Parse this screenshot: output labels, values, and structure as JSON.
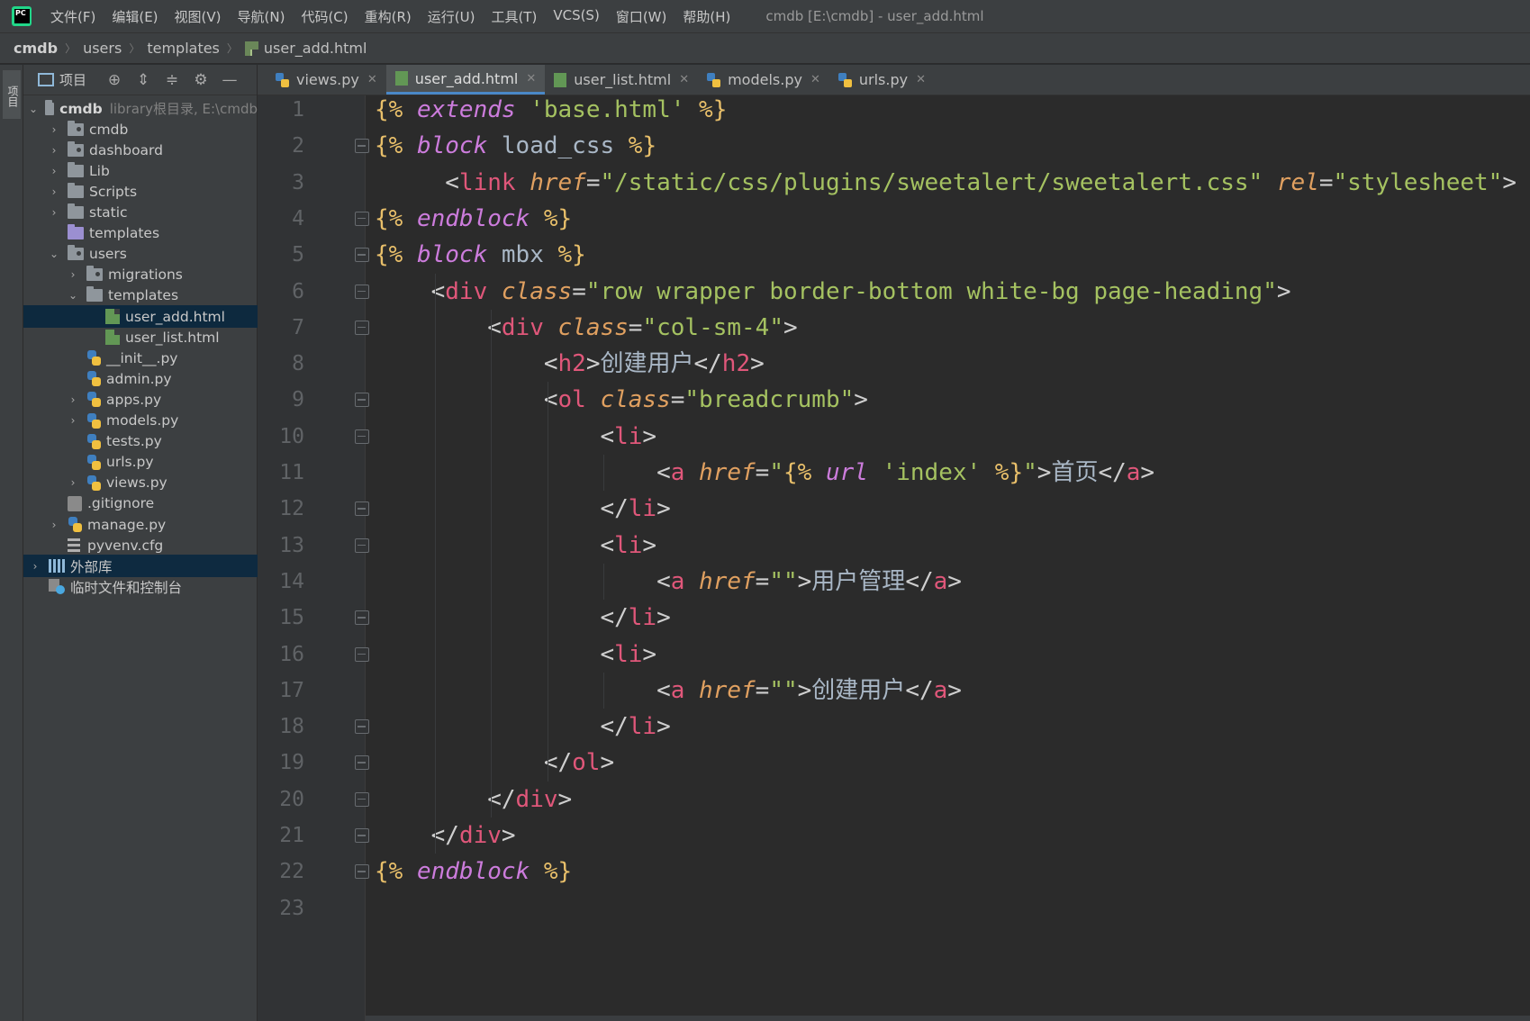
{
  "menubar": {
    "items": [
      "文件(F)",
      "编辑(E)",
      "视图(V)",
      "导航(N)",
      "代码(C)",
      "重构(R)",
      "运行(U)",
      "工具(T)",
      "VCS(S)",
      "窗口(W)",
      "帮助(H)"
    ],
    "window_title": "cmdb [E:\\cmdb] - user_add.html"
  },
  "breadcrumb": {
    "items": [
      "cmdb",
      "users",
      "templates",
      "user_add.html"
    ]
  },
  "tool_stripe": {
    "project_label": "项目"
  },
  "project_panel": {
    "title": "项目",
    "tree": [
      {
        "label": "cmdb",
        "hint": "library根目录, E:\\cmdb",
        "depth": 0,
        "arrow": "down",
        "icon": "folder",
        "bold": true
      },
      {
        "label": "cmdb",
        "depth": 1,
        "arrow": "right",
        "icon": "folder-module"
      },
      {
        "label": "dashboard",
        "depth": 1,
        "arrow": "right",
        "icon": "folder-module"
      },
      {
        "label": "Lib",
        "depth": 1,
        "arrow": "right",
        "icon": "folder"
      },
      {
        "label": "Scripts",
        "depth": 1,
        "arrow": "right",
        "icon": "folder"
      },
      {
        "label": "static",
        "depth": 1,
        "arrow": "right",
        "icon": "folder"
      },
      {
        "label": "templates",
        "depth": 1,
        "arrow": "none",
        "icon": "folder-templates"
      },
      {
        "label": "users",
        "depth": 1,
        "arrow": "down",
        "icon": "folder-module"
      },
      {
        "label": "migrations",
        "depth": 2,
        "arrow": "right",
        "icon": "folder-module"
      },
      {
        "label": "templates",
        "depth": 2,
        "arrow": "down",
        "icon": "folder"
      },
      {
        "label": "user_add.html",
        "depth": 3,
        "arrow": "none",
        "icon": "html",
        "selected": true
      },
      {
        "label": "user_list.html",
        "depth": 3,
        "arrow": "none",
        "icon": "html"
      },
      {
        "label": "__init__.py",
        "depth": 2,
        "arrow": "none",
        "icon": "py"
      },
      {
        "label": "admin.py",
        "depth": 2,
        "arrow": "none",
        "icon": "py"
      },
      {
        "label": "apps.py",
        "depth": 2,
        "arrow": "right",
        "icon": "py"
      },
      {
        "label": "models.py",
        "depth": 2,
        "arrow": "right",
        "icon": "py"
      },
      {
        "label": "tests.py",
        "depth": 2,
        "arrow": "none",
        "icon": "py"
      },
      {
        "label": "urls.py",
        "depth": 2,
        "arrow": "none",
        "icon": "py"
      },
      {
        "label": "views.py",
        "depth": 2,
        "arrow": "right",
        "icon": "py"
      },
      {
        "label": ".gitignore",
        "depth": 1,
        "arrow": "none",
        "icon": "git"
      },
      {
        "label": "manage.py",
        "depth": 1,
        "arrow": "right",
        "icon": "py"
      },
      {
        "label": "pyvenv.cfg",
        "depth": 1,
        "arrow": "none",
        "icon": "cfg"
      },
      {
        "label": "外部库",
        "depth": 0,
        "arrow": "right",
        "icon": "library",
        "library_selected": true
      },
      {
        "label": "临时文件和控制台",
        "depth": 0,
        "arrow": "none",
        "icon": "scratch"
      }
    ]
  },
  "tabs": [
    {
      "label": "views.py",
      "icon": "py",
      "active": false
    },
    {
      "label": "user_add.html",
      "icon": "html",
      "active": true
    },
    {
      "label": "user_list.html",
      "icon": "html",
      "active": false
    },
    {
      "label": "models.py",
      "icon": "py",
      "active": false
    },
    {
      "label": "urls.py",
      "icon": "py",
      "active": false
    }
  ],
  "editor": {
    "lines": [
      {
        "n": "1",
        "fold": "",
        "tokens": [
          [
            "tpl",
            "{% "
          ],
          [
            "kw",
            "extends"
          ],
          [
            "plain",
            " "
          ],
          [
            "str",
            "'base.html'"
          ],
          [
            "tpl",
            " %}"
          ]
        ]
      },
      {
        "n": "2",
        "fold": "open",
        "tokens": [
          [
            "tpl",
            "{% "
          ],
          [
            "kw",
            "block"
          ],
          [
            "plain",
            " load_css "
          ],
          [
            "tpl",
            "%}"
          ]
        ]
      },
      {
        "n": "3",
        "fold": "",
        "tokens": [
          [
            "plain",
            "     "
          ],
          [
            "bracket",
            "<"
          ],
          [
            "tagname",
            "link"
          ],
          [
            "plain",
            " "
          ],
          [
            "attr",
            "href"
          ],
          [
            "bracket",
            "="
          ],
          [
            "str",
            "\"/static/css/plugins/sweetalert/sweetalert.css\""
          ],
          [
            "plain",
            " "
          ],
          [
            "attr",
            "rel"
          ],
          [
            "bracket",
            "="
          ],
          [
            "str",
            "\"stylesheet\""
          ],
          [
            "bracket",
            ">"
          ]
        ]
      },
      {
        "n": "4",
        "fold": "close",
        "tokens": [
          [
            "tpl",
            "{% "
          ],
          [
            "kw",
            "endblock"
          ],
          [
            "plain",
            " "
          ],
          [
            "tpl",
            "%}"
          ]
        ]
      },
      {
        "n": "5",
        "fold": "open",
        "tokens": [
          [
            "tpl",
            "{% "
          ],
          [
            "kw",
            "block"
          ],
          [
            "plain",
            " mbx "
          ],
          [
            "tpl",
            "%}"
          ]
        ]
      },
      {
        "n": "6",
        "fold": "open",
        "tokens": [
          [
            "plain",
            "    "
          ],
          [
            "bracket",
            "<"
          ],
          [
            "tagname",
            "div"
          ],
          [
            "plain",
            " "
          ],
          [
            "attr",
            "class"
          ],
          [
            "bracket",
            "="
          ],
          [
            "str",
            "\"row wrapper border-bottom white-bg page-heading\""
          ],
          [
            "bracket",
            ">"
          ]
        ]
      },
      {
        "n": "7",
        "fold": "open",
        "tokens": [
          [
            "plain",
            "        "
          ],
          [
            "bracket",
            "<"
          ],
          [
            "tagname",
            "div"
          ],
          [
            "plain",
            " "
          ],
          [
            "attr",
            "class"
          ],
          [
            "bracket",
            "="
          ],
          [
            "str",
            "\"col-sm-4\""
          ],
          [
            "bracket",
            ">"
          ]
        ]
      },
      {
        "n": "8",
        "fold": "",
        "tokens": [
          [
            "plain",
            "            "
          ],
          [
            "bracket",
            "<"
          ],
          [
            "tagname",
            "h2"
          ],
          [
            "bracket",
            ">"
          ],
          [
            "plain",
            "创建用户"
          ],
          [
            "bracket",
            "</"
          ],
          [
            "tagname",
            "h2"
          ],
          [
            "bracket",
            ">"
          ]
        ]
      },
      {
        "n": "9",
        "fold": "open",
        "tokens": [
          [
            "plain",
            "            "
          ],
          [
            "bracket",
            "<"
          ],
          [
            "tagname",
            "ol"
          ],
          [
            "plain",
            " "
          ],
          [
            "attr",
            "class"
          ],
          [
            "bracket",
            "="
          ],
          [
            "str",
            "\"breadcrumb\""
          ],
          [
            "bracket",
            ">"
          ]
        ]
      },
      {
        "n": "10",
        "fold": "open",
        "tokens": [
          [
            "plain",
            "                "
          ],
          [
            "bracket",
            "<"
          ],
          [
            "tagname",
            "li"
          ],
          [
            "bracket",
            ">"
          ]
        ]
      },
      {
        "n": "11",
        "fold": "",
        "tokens": [
          [
            "plain",
            "                    "
          ],
          [
            "bracket",
            "<"
          ],
          [
            "tagname",
            "a"
          ],
          [
            "plain",
            " "
          ],
          [
            "attr",
            "href"
          ],
          [
            "bracket",
            "="
          ],
          [
            "str",
            "\""
          ],
          [
            "tpl",
            "{% "
          ],
          [
            "kw",
            "url"
          ],
          [
            "plain",
            " "
          ],
          [
            "str",
            "'index'"
          ],
          [
            "tpl",
            " %}"
          ],
          [
            "str",
            "\""
          ],
          [
            "bracket",
            ">"
          ],
          [
            "plain",
            "首页"
          ],
          [
            "bracket",
            "</"
          ],
          [
            "tagname",
            "a"
          ],
          [
            "bracket",
            ">"
          ]
        ]
      },
      {
        "n": "12",
        "fold": "close",
        "tokens": [
          [
            "plain",
            "                "
          ],
          [
            "bracket",
            "</"
          ],
          [
            "tagname",
            "li"
          ],
          [
            "bracket",
            ">"
          ]
        ]
      },
      {
        "n": "13",
        "fold": "open",
        "tokens": [
          [
            "plain",
            "                "
          ],
          [
            "bracket",
            "<"
          ],
          [
            "tagname",
            "li"
          ],
          [
            "bracket",
            ">"
          ]
        ]
      },
      {
        "n": "14",
        "fold": "",
        "tokens": [
          [
            "plain",
            "                    "
          ],
          [
            "bracket",
            "<"
          ],
          [
            "tagname",
            "a"
          ],
          [
            "plain",
            " "
          ],
          [
            "attr",
            "href"
          ],
          [
            "bracket",
            "="
          ],
          [
            "str",
            "\"\""
          ],
          [
            "bracket",
            ">"
          ],
          [
            "plain",
            "用户管理"
          ],
          [
            "bracket",
            "</"
          ],
          [
            "tagname",
            "a"
          ],
          [
            "bracket",
            ">"
          ]
        ]
      },
      {
        "n": "15",
        "fold": "close",
        "tokens": [
          [
            "plain",
            "                "
          ],
          [
            "bracket",
            "</"
          ],
          [
            "tagname",
            "li"
          ],
          [
            "bracket",
            ">"
          ]
        ]
      },
      {
        "n": "16",
        "fold": "open",
        "tokens": [
          [
            "plain",
            "                "
          ],
          [
            "bracket",
            "<"
          ],
          [
            "tagname",
            "li"
          ],
          [
            "bracket",
            ">"
          ]
        ]
      },
      {
        "n": "17",
        "fold": "",
        "tokens": [
          [
            "plain",
            "                    "
          ],
          [
            "bracket",
            "<"
          ],
          [
            "tagname",
            "a"
          ],
          [
            "plain",
            " "
          ],
          [
            "attr",
            "href"
          ],
          [
            "bracket",
            "="
          ],
          [
            "str",
            "\"\""
          ],
          [
            "bracket",
            ">"
          ],
          [
            "plain",
            "创建用户"
          ],
          [
            "bracket",
            "</"
          ],
          [
            "tagname",
            "a"
          ],
          [
            "bracket",
            ">"
          ]
        ]
      },
      {
        "n": "18",
        "fold": "close",
        "tokens": [
          [
            "plain",
            "                "
          ],
          [
            "bracket",
            "</"
          ],
          [
            "tagname",
            "li"
          ],
          [
            "bracket",
            ">"
          ]
        ]
      },
      {
        "n": "19",
        "fold": "close",
        "tokens": [
          [
            "plain",
            "            "
          ],
          [
            "bracket",
            "</"
          ],
          [
            "tagname",
            "ol"
          ],
          [
            "bracket",
            ">"
          ]
        ]
      },
      {
        "n": "20",
        "fold": "close",
        "tokens": [
          [
            "plain",
            "        "
          ],
          [
            "bracket",
            "</"
          ],
          [
            "tagname",
            "div"
          ],
          [
            "bracket",
            ">"
          ]
        ]
      },
      {
        "n": "21",
        "fold": "close",
        "tokens": [
          [
            "plain",
            "    "
          ],
          [
            "bracket",
            "</"
          ],
          [
            "tagname",
            "div"
          ],
          [
            "bracket",
            ">"
          ]
        ]
      },
      {
        "n": "22",
        "fold": "close",
        "tokens": [
          [
            "tpl",
            "{% "
          ],
          [
            "kw",
            "endblock"
          ],
          [
            "plain",
            " "
          ],
          [
            "tpl",
            "%}"
          ]
        ]
      },
      {
        "n": "23",
        "fold": "",
        "tokens": []
      }
    ]
  },
  "colors": {
    "accent": "#4a88c7",
    "tag_name": "#e0577a",
    "attribute": "#e0a060",
    "string": "#a5c261",
    "template_tag": "#e8bf6a",
    "keyword": "#cc7cdc"
  }
}
